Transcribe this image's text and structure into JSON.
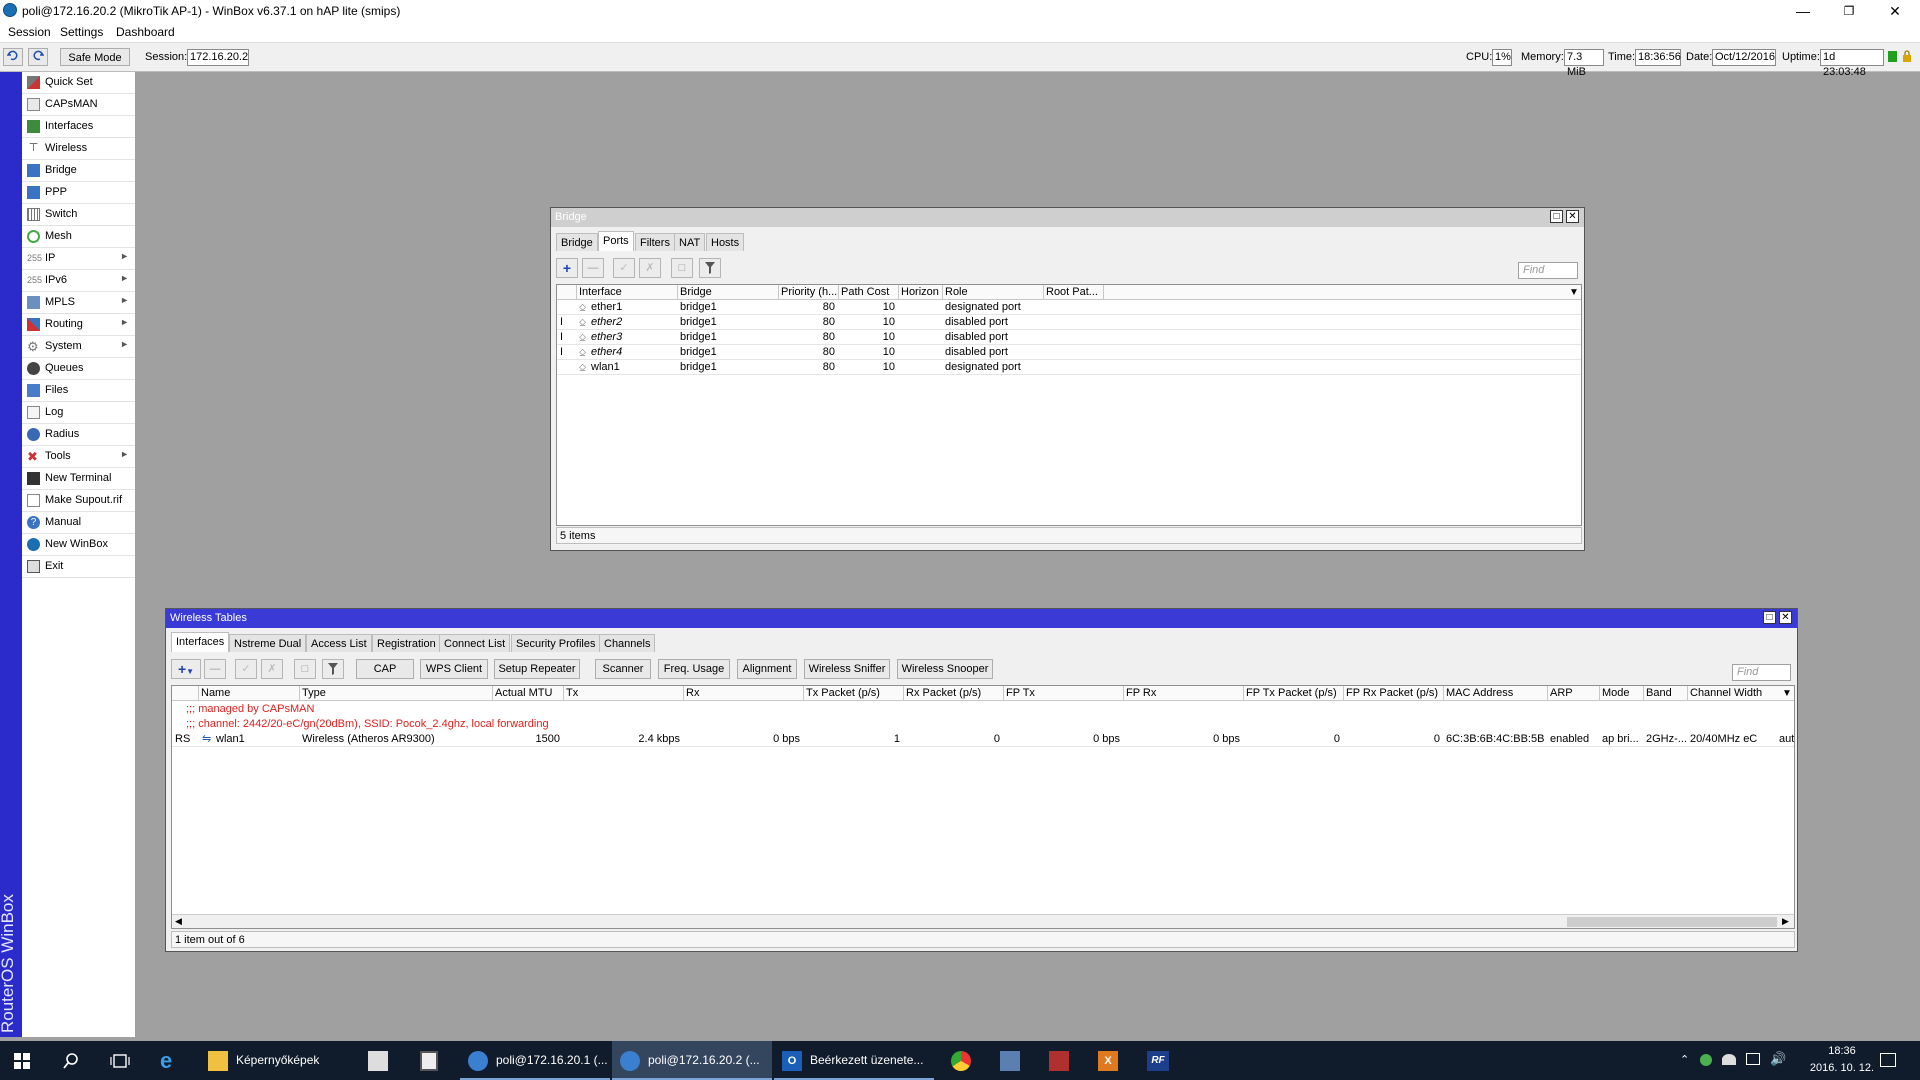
{
  "window": {
    "title": "poli@172.16.20.2 (MikroTik AP-1) - WinBox v6.37.1 on hAP lite (smips)"
  },
  "menu": [
    "Session",
    "Settings",
    "Dashboard"
  ],
  "toolbar": {
    "safe_mode": "Safe Mode",
    "session_label": "Session:",
    "session_value": "172.16.20.2",
    "cpu_label": "CPU:",
    "cpu_value": "1%",
    "memory_label": "Memory:",
    "memory_value": "7.3 MiB",
    "time_label": "Time:",
    "time_value": "18:36:56",
    "date_label": "Date:",
    "date_value": "Oct/12/2016",
    "uptime_label": "Uptime:",
    "uptime_value": "1d 23:03:48"
  },
  "rail_text": "RouterOS WinBox",
  "sidebar": [
    {
      "label": "Quick Set",
      "icon": "wand-icon",
      "sub": false
    },
    {
      "label": "CAPsMAN",
      "icon": "capsman-icon",
      "sub": false
    },
    {
      "label": "Interfaces",
      "icon": "interfaces-icon",
      "sub": false
    },
    {
      "label": "Wireless",
      "icon": "wireless-icon",
      "sub": false
    },
    {
      "label": "Bridge",
      "icon": "bridge-icon",
      "sub": false
    },
    {
      "label": "PPP",
      "icon": "ppp-icon",
      "sub": false
    },
    {
      "label": "Switch",
      "icon": "switch-icon",
      "sub": false
    },
    {
      "label": "Mesh",
      "icon": "mesh-icon",
      "sub": false
    },
    {
      "label": "IP",
      "icon": "ip-icon",
      "sub": true
    },
    {
      "label": "IPv6",
      "icon": "ipv6-icon",
      "sub": true
    },
    {
      "label": "MPLS",
      "icon": "mpls-icon",
      "sub": true
    },
    {
      "label": "Routing",
      "icon": "routing-icon",
      "sub": true
    },
    {
      "label": "System",
      "icon": "system-gear-icon",
      "sub": true
    },
    {
      "label": "Queues",
      "icon": "queues-icon",
      "sub": false
    },
    {
      "label": "Files",
      "icon": "files-icon",
      "sub": false
    },
    {
      "label": "Log",
      "icon": "log-icon",
      "sub": false
    },
    {
      "label": "Radius",
      "icon": "radius-icon",
      "sub": false
    },
    {
      "label": "Tools",
      "icon": "tools-icon",
      "sub": true
    },
    {
      "label": "New Terminal",
      "icon": "terminal-icon",
      "sub": false
    },
    {
      "label": "Make Supout.rif",
      "icon": "supout-icon",
      "sub": false
    },
    {
      "label": "Manual",
      "icon": "manual-icon",
      "sub": false
    },
    {
      "label": "New WinBox",
      "icon": "winbox-icon",
      "sub": false
    },
    {
      "label": "Exit",
      "icon": "exit-icon",
      "sub": false
    }
  ],
  "bridge": {
    "title": "Bridge",
    "tabs": [
      "Bridge",
      "Ports",
      "Filters",
      "NAT",
      "Hosts"
    ],
    "active_tab": 1,
    "find_placeholder": "Find",
    "columns": [
      "Interface",
      "Bridge",
      "Priority (h...",
      "Path Cost",
      "Horizon",
      "Role",
      "Root Pat..."
    ],
    "rows": [
      {
        "flag": "",
        "interface": "ether1",
        "bridge": "bridge1",
        "priority": "80",
        "path_cost": "10",
        "horizon": "",
        "role": "designated port",
        "root": "",
        "italic": false
      },
      {
        "flag": "I",
        "interface": "ether2",
        "bridge": "bridge1",
        "priority": "80",
        "path_cost": "10",
        "horizon": "",
        "role": "disabled port",
        "root": "",
        "italic": true
      },
      {
        "flag": "I",
        "interface": "ether3",
        "bridge": "bridge1",
        "priority": "80",
        "path_cost": "10",
        "horizon": "",
        "role": "disabled port",
        "root": "",
        "italic": true
      },
      {
        "flag": "I",
        "interface": "ether4",
        "bridge": "bridge1",
        "priority": "80",
        "path_cost": "10",
        "horizon": "",
        "role": "disabled port",
        "root": "",
        "italic": true
      },
      {
        "flag": "",
        "interface": "wlan1",
        "bridge": "bridge1",
        "priority": "80",
        "path_cost": "10",
        "horizon": "",
        "role": "designated port",
        "root": "",
        "italic": false
      }
    ],
    "status": "5 items"
  },
  "wireless": {
    "title": "Wireless Tables",
    "tabs": [
      "Interfaces",
      "Nstreme Dual",
      "Access List",
      "Registration",
      "Connect List",
      "Security Profiles",
      "Channels"
    ],
    "active_tab": 0,
    "buttons": [
      "CAP",
      "WPS Client",
      "Setup Repeater",
      "Scanner",
      "Freq. Usage",
      "Alignment",
      "Wireless Sniffer",
      "Wireless Snooper"
    ],
    "find_placeholder": "Find",
    "columns": [
      "Name",
      "Type",
      "Actual MTU",
      "Tx",
      "Rx",
      "Tx Packet (p/s)",
      "Rx Packet (p/s)",
      "FP Tx",
      "FP Rx",
      "FP Tx Packet (p/s)",
      "FP Rx Packet (p/s)",
      "MAC Address",
      "ARP",
      "Mode",
      "Band",
      "Channel Width"
    ],
    "comment1": ";;; managed by CAPsMAN",
    "comment2": ";;; channel: 2442/20-eC/gn(20dBm), SSID: Pocok_2.4ghz, local forwarding",
    "row": {
      "flag": "RS",
      "name": "wlan1",
      "type": "Wireless (Atheros AR9300)",
      "mtu": "1500",
      "tx": "2.4 kbps",
      "rx": "0 bps",
      "txp": "1",
      "rxp": "0",
      "fptx": "0 bps",
      "fprx": "0 bps",
      "fptxp": "0",
      "fprxp": "0",
      "mac": "6C:3B:6B:4C:BB:5B",
      "arp": "enabled",
      "mode": "ap bri...",
      "band": "2GHz-...",
      "cw": "20/40MHz eC",
      "extra": "aut"
    },
    "status": "1 item out of 6"
  },
  "taskbar": {
    "items": [
      {
        "label": "Képernyőképek",
        "icon": "folder-icon"
      },
      {
        "label": "poli@172.16.20.1 (...",
        "icon": "winbox-icon"
      },
      {
        "label": "poli@172.16.20.2 (...",
        "icon": "winbox-icon"
      },
      {
        "label": "Beérkezett üzenete...",
        "icon": "outlook-icon"
      }
    ],
    "time": "18:36",
    "date": "2016. 10. 12."
  },
  "colors": {
    "rail": "#2b2bcc",
    "wireless_title": "#3a3ad6",
    "comment": "#e02020",
    "taskbar": "#101b2b"
  }
}
